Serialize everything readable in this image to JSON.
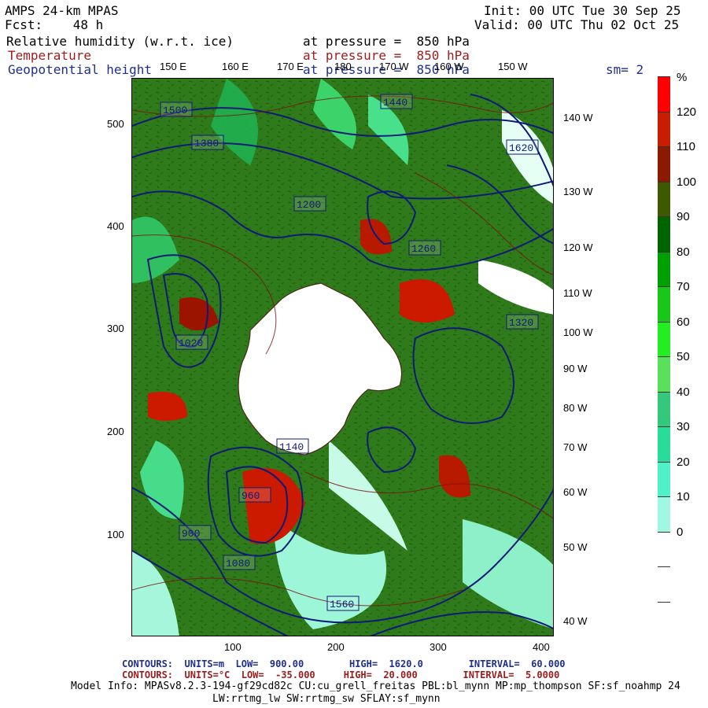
{
  "header": {
    "model": "AMPS 24-km MPAS",
    "fcst": "Fcst:    48 h",
    "init": "Init: 00 UTC Tue 30 Sep 25",
    "valid": "Valid: 00 UTC Thu 02 Oct 25"
  },
  "fields": [
    {
      "name": "Relative humidity (w.r.t. ice)",
      "level": "at pressure =  850 hPa",
      "color": "#000000"
    },
    {
      "name": "Temperature",
      "level": "at pressure =  850 hPa",
      "color": "#9b1c1c"
    },
    {
      "name": "Geopotential height",
      "level": "at pressure =  850 hPa",
      "color": "#1f2f8c"
    }
  ],
  "smoothing": "sm= 2",
  "axes": {
    "top_lon": [
      "150 E",
      "160 E",
      "170 E",
      "180",
      "170 W",
      "160 W",
      "150 W"
    ],
    "right_lon": [
      "140 W",
      "130 W",
      "120 W",
      "110 W",
      "100 W",
      "90 W",
      "80 W",
      "70 W",
      "60 W",
      "50 W",
      "40 W"
    ],
    "left_y": [
      "500",
      "400",
      "300",
      "200",
      "100"
    ],
    "bottom_x": [
      "100",
      "200",
      "300",
      "400"
    ]
  },
  "colorbar": {
    "unit": "%",
    "labels": [
      "120",
      "110",
      "100",
      "90",
      "80",
      "70",
      "60",
      "50",
      "40",
      "30",
      "20",
      "10",
      "0"
    ],
    "colors": [
      "#ff0000",
      "#c81e00",
      "#8c1a00",
      "#3e5a00",
      "#006400",
      "#00a000",
      "#18c818",
      "#22ee22",
      "#5ae05a",
      "#34c87c",
      "#28dc9a",
      "#50f0c8",
      "#a0f8e0",
      "#ffffff",
      "#ffffff",
      "#ffffff"
    ]
  },
  "contour_labels": [
    "1440",
    "1380",
    "1500",
    "1560",
    "1260",
    "1200",
    "1140",
    "1320",
    "1620",
    "1080",
    "1020",
    "960",
    "900"
  ],
  "footer": {
    "line1": "CONTOURS:  UNITS=m  LOW=  900.00        HIGH=  1620.0        INTERVAL=  60.000",
    "line2": "CONTOURS:  UNITS=°C  LOW=  -35.000     HIGH=  20.000        INTERVAL=  5.0000",
    "model_info": "Model Info: MPASv8.2.3-194-gf29cd82c CU:cu_grell_freitas PBL:bl_mynn MP:mp_thompson SF:sf_noahmp 24",
    "model_info2": "LW:rrtmg_lw SW:rrtmg_sw SFLAY:sf_mynn"
  }
}
